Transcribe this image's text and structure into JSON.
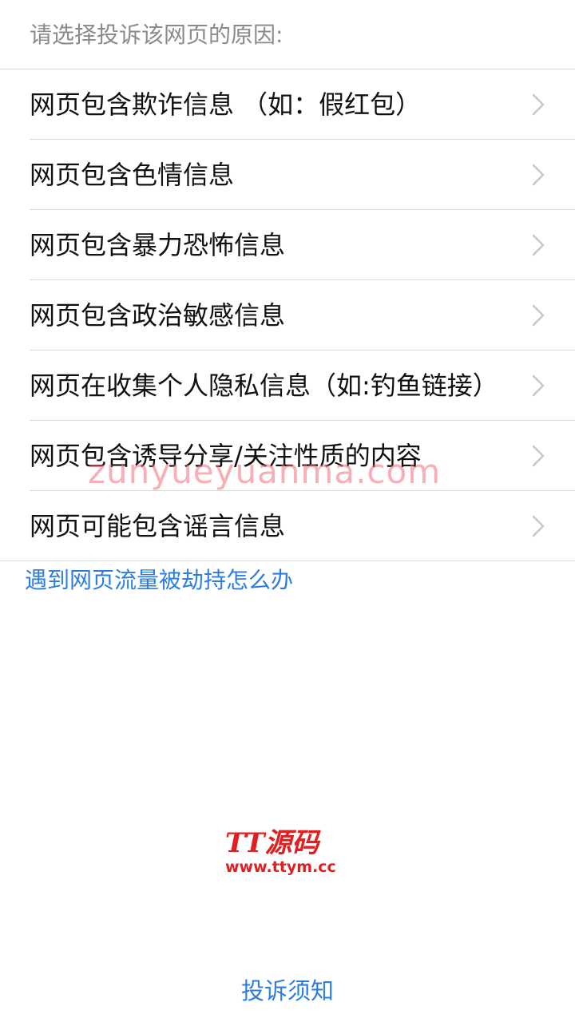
{
  "header": {
    "prompt": "请选择投诉该网页的原因:"
  },
  "reasons": [
    {
      "label": "网页包含欺诈信息 （如：假红包）"
    },
    {
      "label": "网页包含色情信息"
    },
    {
      "label": "网页包含暴力恐怖信息"
    },
    {
      "label": "网页包含政治敏感信息"
    },
    {
      "label": "网页在收集个人隐私信息（如:钓鱼链接）"
    },
    {
      "label": "网页包含诱导分享/关注性质的内容"
    },
    {
      "label": "网页可能包含谣言信息"
    }
  ],
  "hijack_link": "遇到网页流量被劫持怎么办",
  "watermark": {
    "url_text": "zunyueyuanma.com",
    "logo_title": "TT源码",
    "logo_url": "www.ttym.cc"
  },
  "footer": {
    "notice_link": "投诉须知"
  },
  "colors": {
    "link": "#2b7ee0",
    "divider": "#d9d9d9",
    "header_text": "#8a8a8a",
    "logo": "#e02020"
  },
  "icons": {
    "row_arrow": "chevron-right-icon"
  }
}
